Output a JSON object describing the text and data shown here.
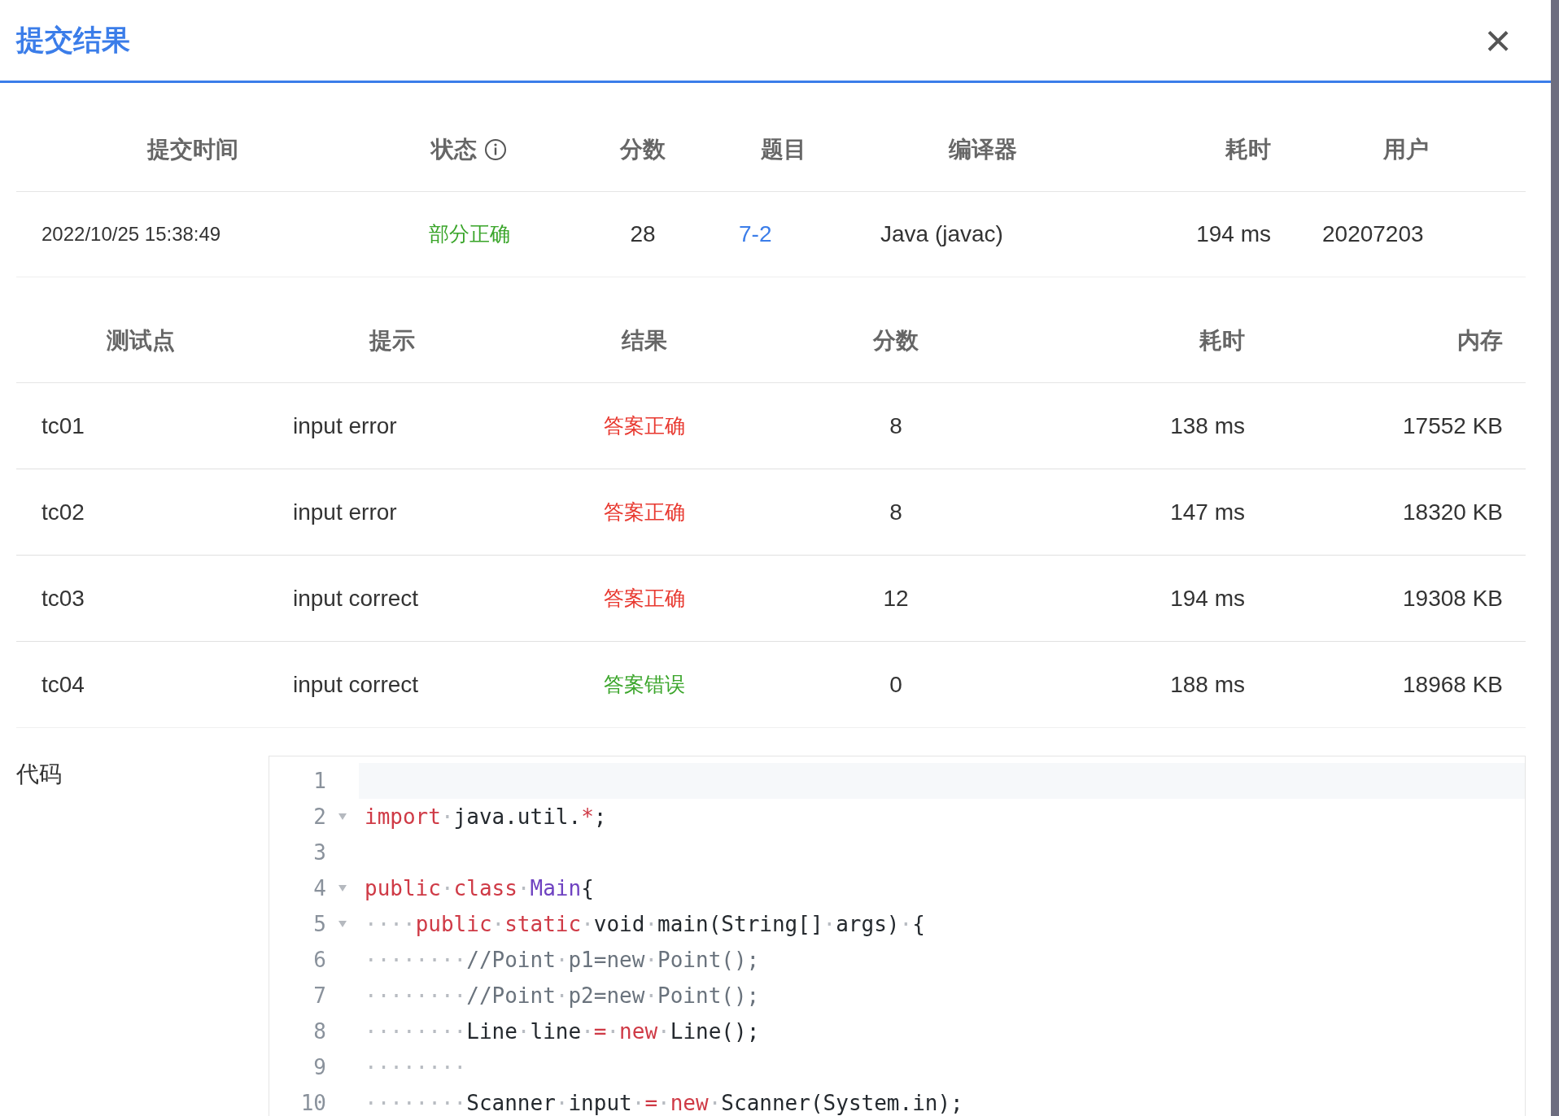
{
  "dialog": {
    "title": "提交结果",
    "close": "×"
  },
  "submission": {
    "columns": [
      {
        "label": "提交时间"
      },
      {
        "label": "状态",
        "info": true
      },
      {
        "label": "分数"
      },
      {
        "label": "题目"
      },
      {
        "label": "编译器"
      },
      {
        "label": "耗时"
      },
      {
        "label": "用户"
      }
    ],
    "row": {
      "time": "2022/10/25 15:38:49",
      "status": {
        "text": "部分正确",
        "color": "#3aa52a"
      },
      "score": "28",
      "problem": "7-2",
      "compiler": "Java (javac)",
      "elapsed": "194 ms",
      "user": "20207203"
    }
  },
  "testcases": {
    "columns": [
      "测试点",
      "提示",
      "结果",
      "分数",
      "耗时",
      "内存"
    ],
    "rows": [
      {
        "id": "tc01",
        "hint": "input error",
        "result": {
          "text": "答案正确",
          "color": "#e8382f"
        },
        "score": "8",
        "time": "138 ms",
        "memory": "17552 KB"
      },
      {
        "id": "tc02",
        "hint": "input error",
        "result": {
          "text": "答案正确",
          "color": "#e8382f"
        },
        "score": "8",
        "time": "147 ms",
        "memory": "18320 KB"
      },
      {
        "id": "tc03",
        "hint": "input correct",
        "result": {
          "text": "答案正确",
          "color": "#e8382f"
        },
        "score": "12",
        "time": "194 ms",
        "memory": "19308 KB"
      },
      {
        "id": "tc04",
        "hint": "input correct",
        "result": {
          "text": "答案错误",
          "color": "#3aa52a"
        },
        "score": "0",
        "time": "188 ms",
        "memory": "18968 KB"
      }
    ]
  },
  "code": {
    "label": "代码",
    "lines": [
      {
        "number": "1",
        "active": true,
        "foldable": false
      },
      {
        "number": "2",
        "active": false,
        "foldable": true,
        "tokens": [
          {
            "kind": "keyword",
            "text": "import"
          },
          {
            "kind": "space",
            "text": "·"
          },
          {
            "kind": "plain",
            "text": "java.util."
          },
          {
            "kind": "operator",
            "text": "*"
          },
          {
            "kind": "plain",
            "text": ";"
          }
        ]
      },
      {
        "number": "3",
        "active": false,
        "foldable": false
      },
      {
        "number": "4",
        "active": false,
        "foldable": true,
        "tokens": [
          {
            "kind": "keyword",
            "text": "public"
          },
          {
            "kind": "space",
            "text": "·"
          },
          {
            "kind": "keyword",
            "text": "class"
          },
          {
            "kind": "space",
            "text": "·"
          },
          {
            "kind": "type",
            "text": "Main"
          },
          {
            "kind": "plain",
            "text": "{"
          }
        ]
      },
      {
        "number": "5",
        "active": false,
        "foldable": true,
        "tokens": [
          {
            "kind": "space",
            "text": "····"
          },
          {
            "kind": "keyword",
            "text": "public"
          },
          {
            "kind": "space",
            "text": "·"
          },
          {
            "kind": "keyword",
            "text": "static"
          },
          {
            "kind": "space",
            "text": "·"
          },
          {
            "kind": "plain",
            "text": "void"
          },
          {
            "kind": "space",
            "text": "·"
          },
          {
            "kind": "plain",
            "text": "main(String[]"
          },
          {
            "kind": "space",
            "text": "·"
          },
          {
            "kind": "plain",
            "text": "args)"
          },
          {
            "kind": "space",
            "text": "·"
          },
          {
            "kind": "plain",
            "text": "{"
          }
        ]
      },
      {
        "number": "6",
        "active": false,
        "foldable": false,
        "tokens": [
          {
            "kind": "space",
            "text": "········"
          },
          {
            "kind": "comment",
            "text": "//Point"
          },
          {
            "kind": "space",
            "text": "·"
          },
          {
            "kind": "comment",
            "text": "p1=new"
          },
          {
            "kind": "space",
            "text": "·"
          },
          {
            "kind": "comment",
            "text": "Point();"
          }
        ]
      },
      {
        "number": "7",
        "active": false,
        "foldable": false,
        "tokens": [
          {
            "kind": "space",
            "text": "········"
          },
          {
            "kind": "comment",
            "text": "//Point"
          },
          {
            "kind": "space",
            "text": "·"
          },
          {
            "kind": "comment",
            "text": "p2=new"
          },
          {
            "kind": "space",
            "text": "·"
          },
          {
            "kind": "comment",
            "text": "Point();"
          }
        ]
      },
      {
        "number": "8",
        "active": false,
        "foldable": false,
        "tokens": [
          {
            "kind": "space",
            "text": "········"
          },
          {
            "kind": "plain",
            "text": "Line"
          },
          {
            "kind": "space",
            "text": "·"
          },
          {
            "kind": "plain",
            "text": "line"
          },
          {
            "kind": "space",
            "text": "·"
          },
          {
            "kind": "operator",
            "text": "="
          },
          {
            "kind": "space",
            "text": "·"
          },
          {
            "kind": "keyword",
            "text": "new"
          },
          {
            "kind": "space",
            "text": "·"
          },
          {
            "kind": "plain",
            "text": "Line();"
          }
        ]
      },
      {
        "number": "9",
        "active": false,
        "foldable": false,
        "tokens": [
          {
            "kind": "space",
            "text": "········"
          }
        ]
      },
      {
        "number": "10",
        "active": false,
        "foldable": false,
        "tokens": [
          {
            "kind": "space",
            "text": "········"
          },
          {
            "kind": "plain",
            "text": "Scanner"
          },
          {
            "kind": "space",
            "text": "·"
          },
          {
            "kind": "plain",
            "text": "input"
          },
          {
            "kind": "space",
            "text": "·"
          },
          {
            "kind": "operator",
            "text": "="
          },
          {
            "kind": "space",
            "text": "·"
          },
          {
            "kind": "keyword",
            "text": "new"
          },
          {
            "kind": "space",
            "text": "·"
          },
          {
            "kind": "plain",
            "text": "Scanner(System.in);"
          }
        ]
      }
    ]
  }
}
